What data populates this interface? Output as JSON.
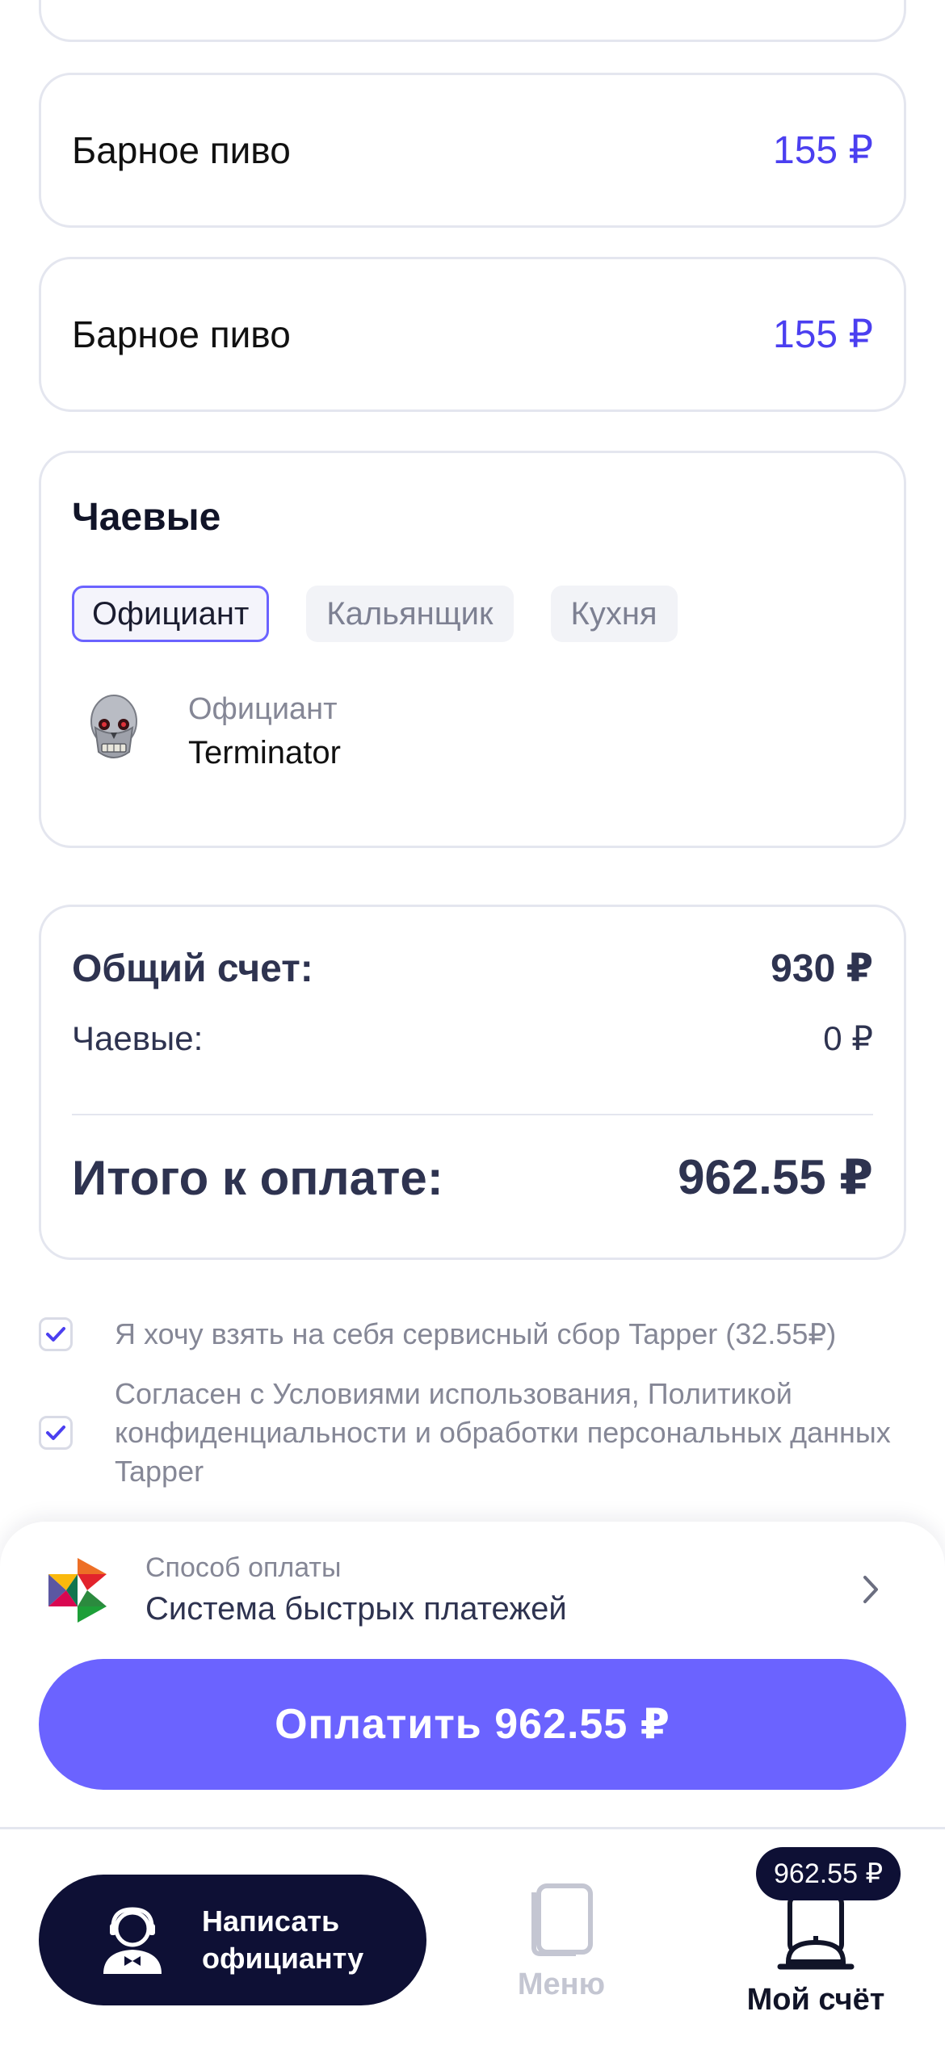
{
  "items": [
    {
      "name": "Барное пиво",
      "price": "155 ₽"
    },
    {
      "name": "Барное пиво",
      "price": "155 ₽"
    }
  ],
  "tips": {
    "title": "Чаевые",
    "tabs": [
      "Официант",
      "Кальянщик",
      "Кухня"
    ],
    "active_tab": "Официант",
    "staff": {
      "role": "Официант",
      "name": "Terminator"
    }
  },
  "totals": {
    "bill_label": "Общий счет:",
    "bill_value": "930 ₽",
    "tips_label": "Чаевые:",
    "tips_value": "0 ₽",
    "total_label": "Итого к оплате:",
    "total_value": "962.55 ₽"
  },
  "consents": [
    {
      "checked": true,
      "text": "Я хочу взять на себя сервисный сбор Tapper (32.55₽)"
    },
    {
      "checked": true,
      "text": "Согласен с Условиями использования, Политикой конфиденциальности и обработки персональных данных Tapper"
    }
  ],
  "payment": {
    "method_label": "Способ оплаты",
    "method_value": "Система быстрых платежей",
    "pay_button": "Оплатить 962.55 ₽"
  },
  "nav": {
    "waiter_button": "Написать официанту",
    "menu_label": "Меню",
    "bill_label": "Мой счёт",
    "bill_badge": "962.55 ₽"
  },
  "colors": {
    "accent": "#6b63ff",
    "price": "#4b3ff0",
    "dark": "#0e1035"
  }
}
